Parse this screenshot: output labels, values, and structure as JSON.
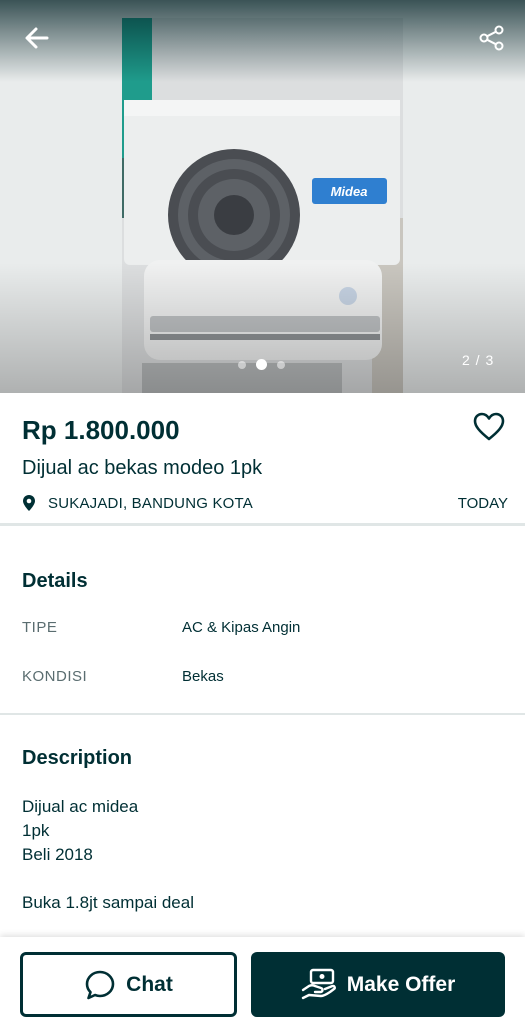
{
  "gallery": {
    "counter": "2 / 3",
    "dot_count": 3,
    "active_index": 1,
    "brand_on_unit": "Midea"
  },
  "listing": {
    "price": "Rp 1.800.000",
    "title": "Dijual ac bekas modeo 1pk",
    "location": "SUKAJADI, BANDUNG KOTA",
    "date": "TODAY"
  },
  "details": {
    "heading": "Details",
    "rows": [
      {
        "key": "TIPE",
        "value": "AC & Kipas Angin"
      },
      {
        "key": "KONDISI",
        "value": "Bekas"
      }
    ]
  },
  "description": {
    "heading": "Description",
    "lines": [
      "Dijual ac midea",
      "1pk",
      "Beli 2018",
      "",
      "Buka 1.8jt sampai deal"
    ]
  },
  "actions": {
    "chat_label": "Chat",
    "offer_label": "Make Offer"
  },
  "icons": {
    "back": "arrow-left-icon",
    "share": "share-icon",
    "favorite": "heart-icon",
    "location": "location-pin-icon",
    "chat": "chat-bubble-icon",
    "offer": "hand-offer-icon"
  },
  "colors": {
    "primary": "#002f34",
    "muted": "#5a6d70",
    "divider": "#e0e6e6"
  }
}
